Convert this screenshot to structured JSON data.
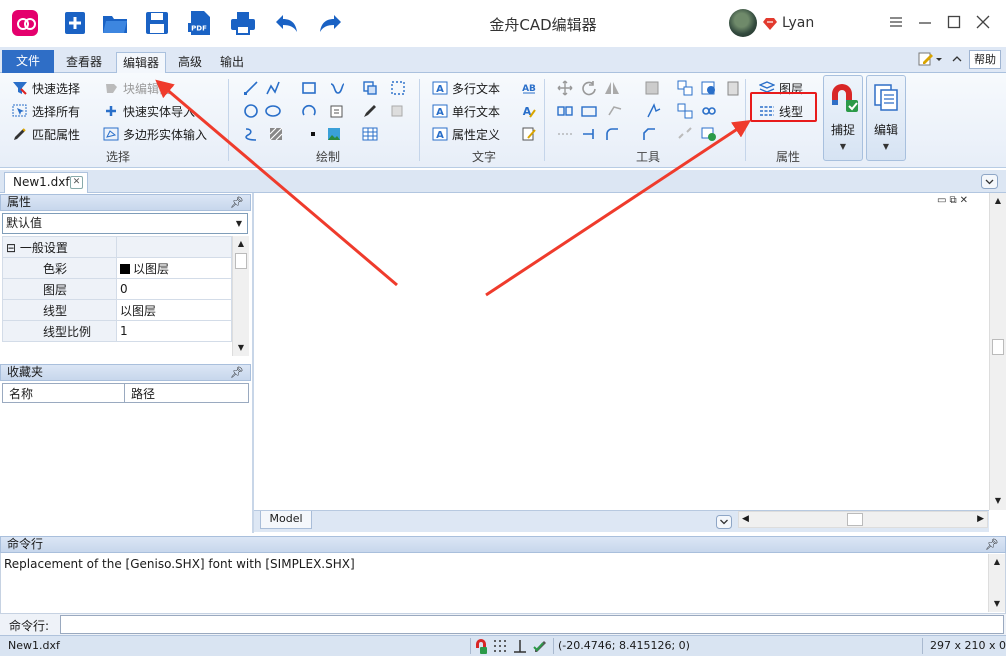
{
  "titlebar": {
    "title": "金舟CAD编辑器",
    "user_name": "Lyan",
    "quick_access": [
      "new-file-icon",
      "open-folder-icon",
      "save-icon",
      "export-pdf-icon",
      "print-icon",
      "undo-icon",
      "redo-icon"
    ],
    "window_controls": [
      "menu-icon",
      "minimize-icon",
      "maximize-icon",
      "close-icon"
    ]
  },
  "ribbon": {
    "tabs": [
      {
        "label": "文件"
      },
      {
        "label": "查看器"
      },
      {
        "label": "编辑器"
      },
      {
        "label": "高级"
      },
      {
        "label": "输出"
      }
    ],
    "active_tab": "编辑器",
    "help_label": "帮助",
    "groups": {
      "select": {
        "label": "选择",
        "quick_select": "快速选择",
        "select_all": "选择所有",
        "match_props": "匹配属性",
        "block_edit": "块编辑器",
        "quick_entity_import": "快速实体导入",
        "polygon_entity_input": "多边形实体输入"
      },
      "draw": {
        "label": "绘制"
      },
      "text": {
        "label": "文字",
        "mtext": "多行文本",
        "stext": "单行文本",
        "attdef": "属性定义"
      },
      "tools": {
        "label": "工具"
      },
      "props": {
        "label": "属性",
        "layer": "图层",
        "linetype": "线型"
      },
      "snap_label": "捕捉",
      "edit_label": "编辑"
    }
  },
  "document": {
    "tab_name": "New1.dxf",
    "layout_tab": "Model"
  },
  "properties_panel": {
    "title": "属性",
    "combo_value": "默认值",
    "section": "一般设置",
    "section_toggle": "⊟",
    "rows": [
      {
        "key": "色彩",
        "value": "以图层"
      },
      {
        "key": "图层",
        "value": "0"
      },
      {
        "key": "线型",
        "value": "以图层"
      },
      {
        "key": "线型比例",
        "value": "1"
      }
    ]
  },
  "favorites_panel": {
    "title": "收藏夹",
    "col_name": "名称",
    "col_path": "路径"
  },
  "command": {
    "title": "命令行",
    "output": "Replacement of the [Geniso.SHX] font with [SIMPLEX.SHX]",
    "input_label": "命令行:",
    "input_value": ""
  },
  "statusbar": {
    "file": "New1.dxf",
    "coords": "(-20.4746; 8.415126; 0)",
    "paper": "297 x 210 x 0"
  },
  "colors": {
    "accent": "#2f6ec6",
    "highlight": "#e81c1c",
    "annotation_arrow": "#ef3b2c"
  }
}
